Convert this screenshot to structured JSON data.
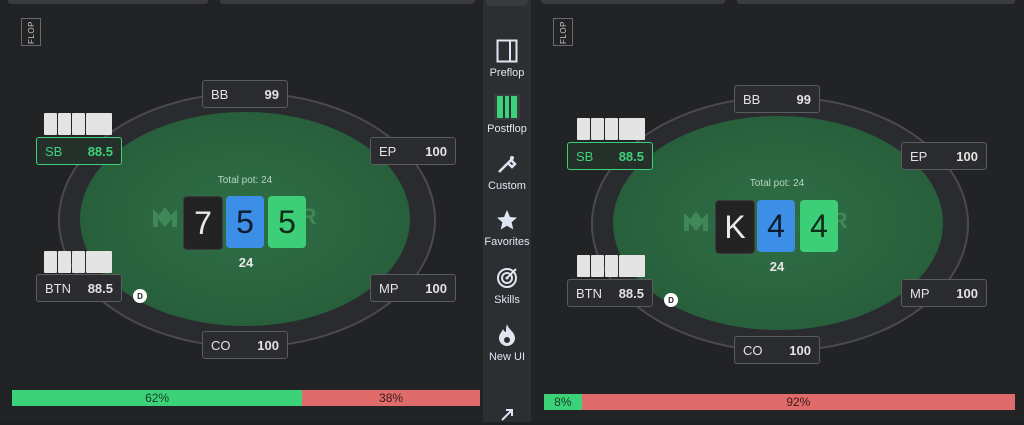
{
  "nav": {
    "items": [
      {
        "label": "Preflop",
        "icon": "preflop-icon"
      },
      {
        "label": "Postflop",
        "icon": "postflop-icon"
      },
      {
        "label": "Custom",
        "icon": "custom-icon"
      },
      {
        "label": "Favorites",
        "icon": "star-icon"
      },
      {
        "label": "Skills",
        "icon": "target-icon"
      },
      {
        "label": "New UI",
        "icon": "flame-icon"
      }
    ],
    "external_icon": "external-link-icon"
  },
  "tables": [
    {
      "street": "FLOP",
      "seats": {
        "bb": {
          "pos": "BB",
          "stack": "99"
        },
        "sb": {
          "pos": "SB",
          "stack": "88.5"
        },
        "ep": {
          "pos": "EP",
          "stack": "100"
        },
        "btn": {
          "pos": "BTN",
          "stack": "88.5"
        },
        "mp": {
          "pos": "MP",
          "stack": "100"
        },
        "co": {
          "pos": "CO",
          "stack": "100"
        }
      },
      "dealer": "D",
      "total_pot_label": "Total pot: 24",
      "pot_value": "24",
      "logo_suffix": "ER",
      "board": [
        "7",
        "5",
        "5"
      ],
      "equity": {
        "win": 62,
        "lose": 38,
        "win_label": "62%",
        "lose_label": "38%"
      }
    },
    {
      "street": "FLOP",
      "seats": {
        "bb": {
          "pos": "BB",
          "stack": "99"
        },
        "sb": {
          "pos": "SB",
          "stack": "88.5"
        },
        "ep": {
          "pos": "EP",
          "stack": "100"
        },
        "btn": {
          "pos": "BTN",
          "stack": "88.5"
        },
        "mp": {
          "pos": "MP",
          "stack": "100"
        },
        "co": {
          "pos": "CO",
          "stack": "100"
        }
      },
      "dealer": "D",
      "total_pot_label": "Total pot: 24",
      "pot_value": "24",
      "logo_suffix": "ER",
      "board": [
        "K",
        "4",
        "4"
      ],
      "equity": {
        "win": 8,
        "lose": 92,
        "win_label": "8%",
        "lose_label": "92%"
      }
    }
  ],
  "colors": {
    "win": "#3bd27a",
    "lose": "#e06b6b",
    "felt": "#2b6640",
    "active_seat": "#3dd27a"
  }
}
